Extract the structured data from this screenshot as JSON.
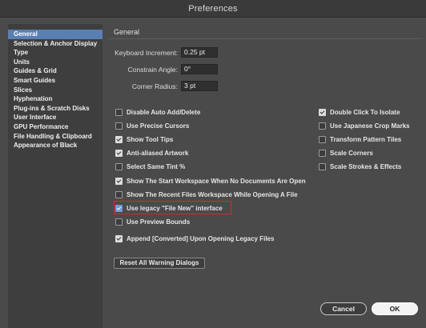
{
  "window": {
    "title": "Preferences"
  },
  "sidebar": {
    "items": [
      {
        "label": "General",
        "selected": true
      },
      {
        "label": "Selection & Anchor Display"
      },
      {
        "label": "Type"
      },
      {
        "label": "Units"
      },
      {
        "label": "Guides & Grid"
      },
      {
        "label": "Smart Guides"
      },
      {
        "label": "Slices"
      },
      {
        "label": "Hyphenation"
      },
      {
        "label": "Plug-ins & Scratch Disks"
      },
      {
        "label": "User Interface"
      },
      {
        "label": "GPU Performance"
      },
      {
        "label": "File Handling & Clipboard"
      },
      {
        "label": "Appearance of Black"
      }
    ]
  },
  "general": {
    "title": "General",
    "keyboard_increment": {
      "label": "Keyboard Increment:",
      "value": "0.25 pt"
    },
    "constrain_angle": {
      "label": "Constrain Angle:",
      "value": "0°"
    },
    "corner_radius": {
      "label": "Corner Radius:",
      "value": "3 pt"
    }
  },
  "left_checks": [
    {
      "label": "Disable Auto Add/Delete",
      "checked": false
    },
    {
      "label": "Use Precise Cursors",
      "checked": false
    },
    {
      "label": "Show Tool Tips",
      "checked": true
    },
    {
      "label": "Anti-aliased Artwork",
      "checked": true
    },
    {
      "label": "Select Same Tint %",
      "checked": false
    },
    {
      "label": "Show The Start Workspace When No Documents Are Open",
      "checked": true
    },
    {
      "label": "Show The Recent Files Workspace While Opening A File",
      "checked": false
    },
    {
      "label": "Use legacy \"File New\" interface",
      "checked": true,
      "highlighted": true
    },
    {
      "label": "Use Preview Bounds",
      "checked": false
    },
    {
      "label": "Append [Converted] Upon Opening Legacy Files",
      "checked": true
    }
  ],
  "right_checks": [
    {
      "label": "Double Click To Isolate",
      "checked": true
    },
    {
      "label": "Use Japanese Crop Marks",
      "checked": false
    },
    {
      "label": "Transform Pattern Tiles",
      "checked": false
    },
    {
      "label": "Scale Corners",
      "checked": false
    },
    {
      "label": "Scale Strokes & Effects",
      "checked": false
    }
  ],
  "buttons": {
    "reset_warnings": "Reset All Warning Dialogs",
    "cancel": "Cancel",
    "ok": "OK"
  },
  "colors": {
    "selection": "#5a7fb3",
    "highlight_border": "#d32b2b",
    "dialog_bg": "#4a4a4a"
  }
}
